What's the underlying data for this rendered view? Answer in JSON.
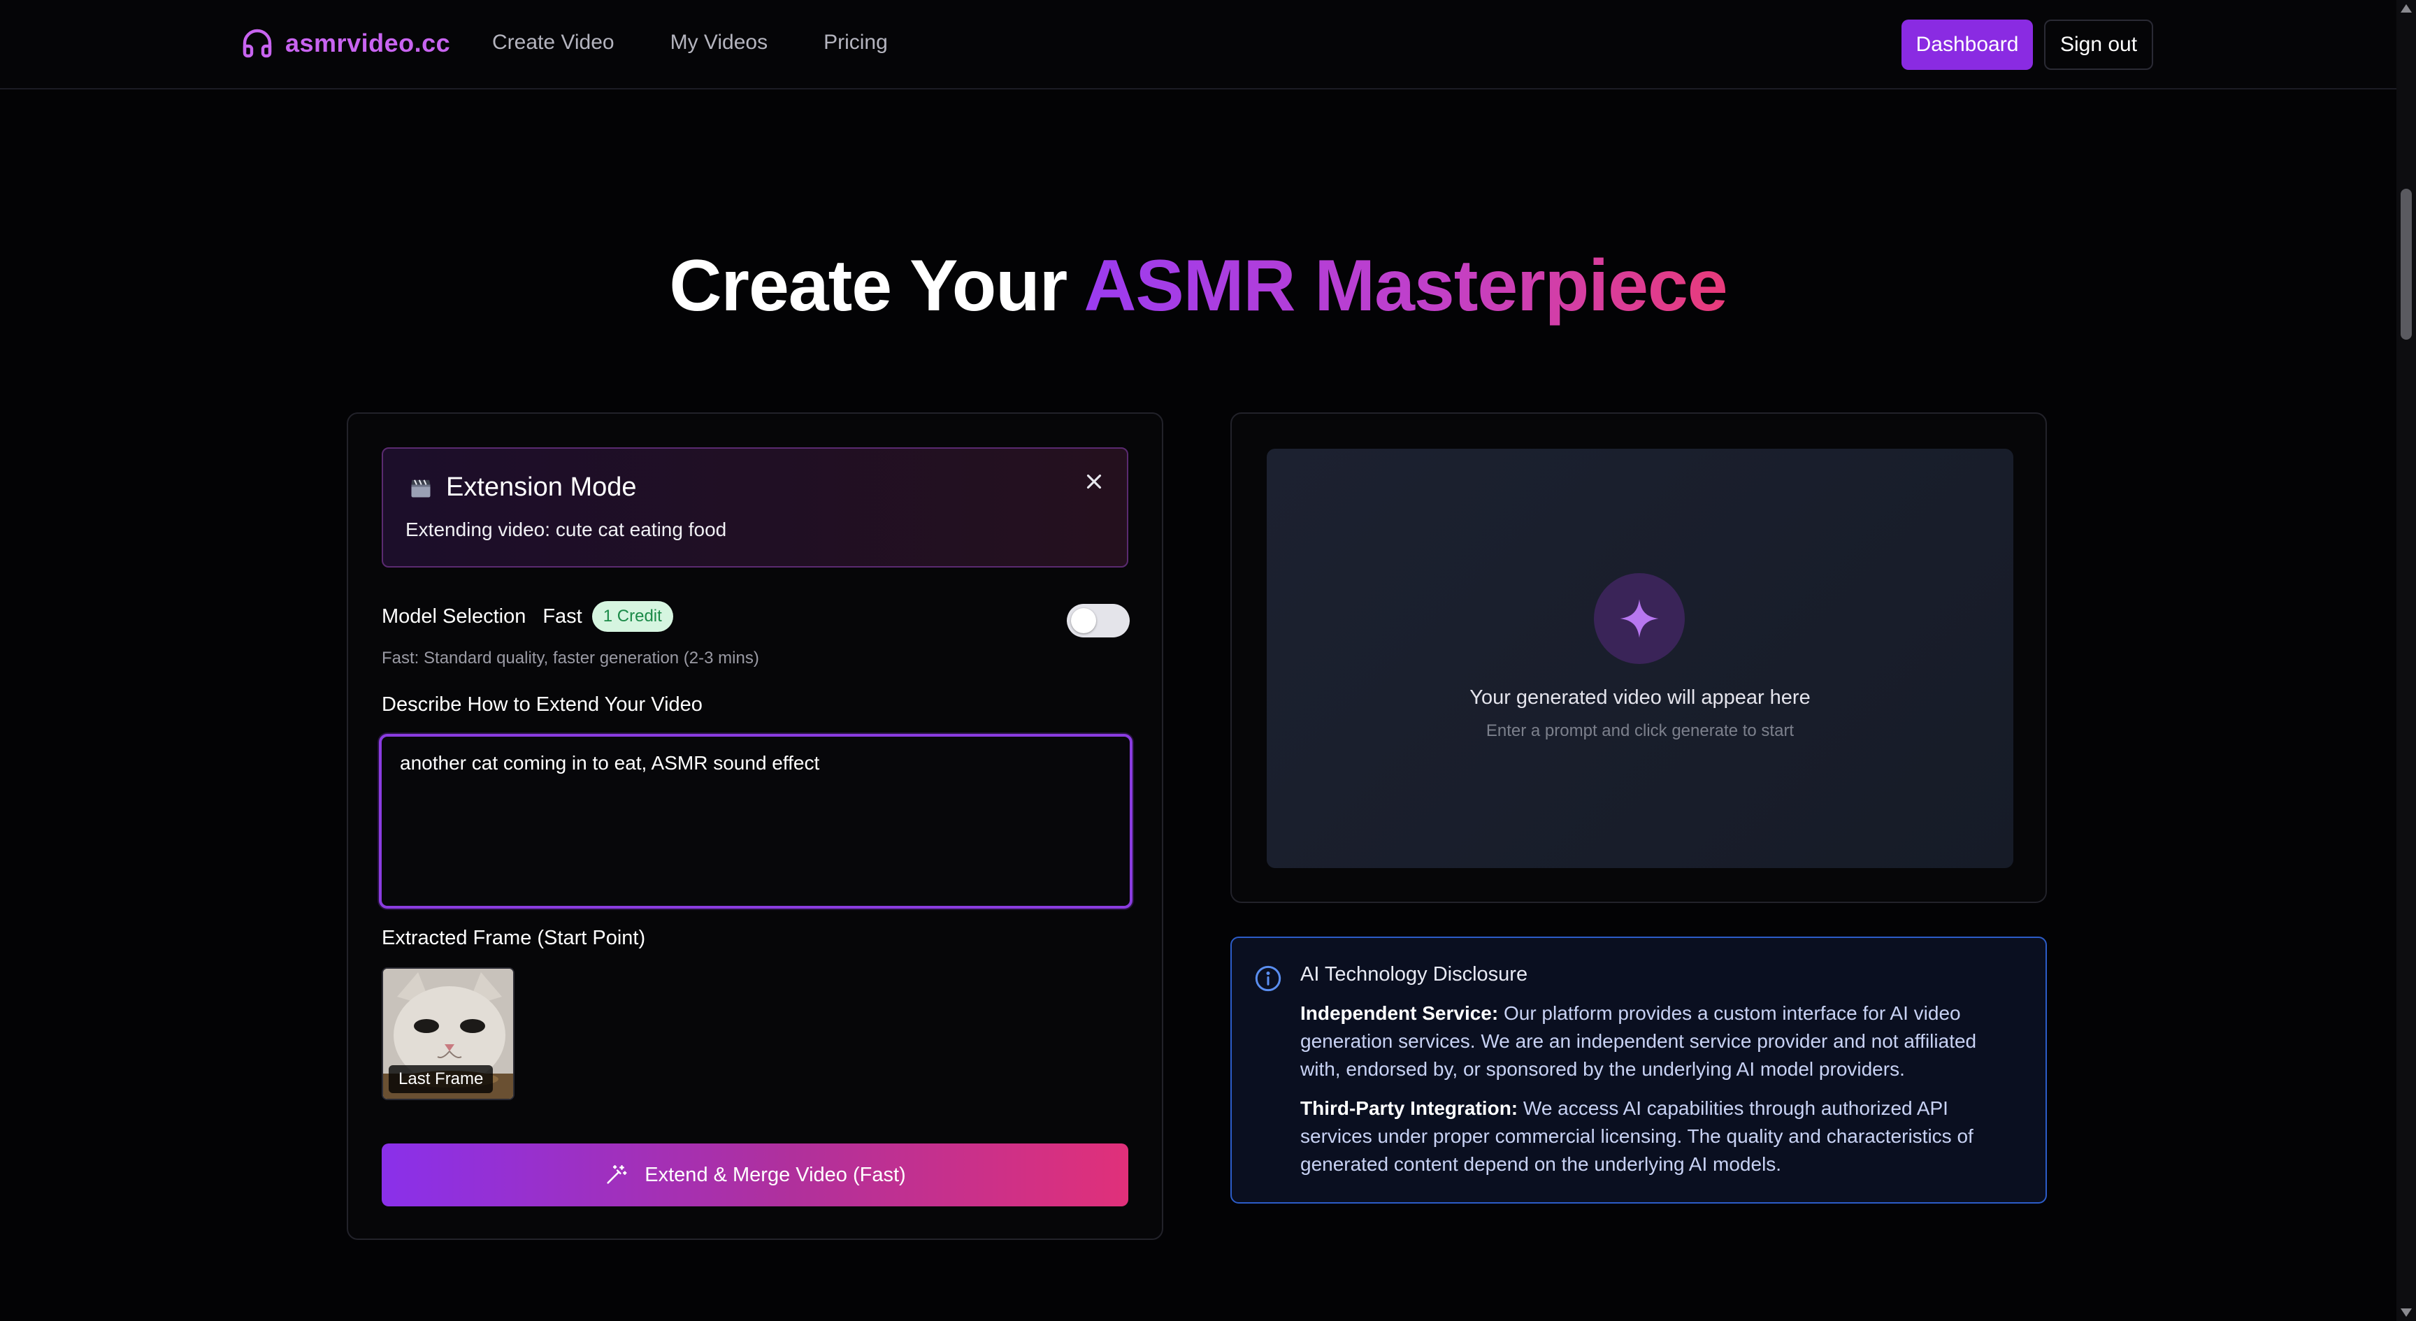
{
  "nav": {
    "brand": "asmrvideo.cc",
    "links": [
      "Create Video",
      "My Videos",
      "Pricing"
    ],
    "dashboard_label": "Dashboard",
    "signout_label": "Sign out",
    "brand_color": "#c864f0"
  },
  "hero": {
    "title_plain": "Create Your ",
    "title_highlight": "ASMR Masterpiece"
  },
  "extension": {
    "icon": "clapperboard-icon",
    "title": "Extension Mode",
    "subtitle": "Extending video: cute cat eating food"
  },
  "model": {
    "label": "Model Selection",
    "mode": "Fast",
    "credit_badge": "1 Credit",
    "toggle_on": false,
    "hint": "Fast: Standard quality, faster generation (2-3 mins)"
  },
  "prompt": {
    "label": "Describe How to Extend Your Video",
    "value": "another cat coming in to eat, ASMR sound effect"
  },
  "frame": {
    "label": "Extracted Frame (Start Point)",
    "tag": "Last Frame"
  },
  "extend_button": {
    "label": "Extend & Merge Video (Fast)",
    "icon": "magic-wand-icon"
  },
  "preview": {
    "title": "Your generated video will appear here",
    "subtitle": "Enter a prompt and click generate to start",
    "icon": "sparkle-icon"
  },
  "disclosure": {
    "icon": "info-icon",
    "title": "AI Technology Disclosure",
    "p1_bold": "Independent Service:",
    "p1_text": " Our platform provides a custom interface for AI video generation services. We are an independent service provider and not affiliated with, endorsed by, or sponsored by the underlying AI model providers.",
    "p2_bold": "Third-Party Integration:",
    "p2_text": " We access AI capabilities through authorized API services under proper commercial licensing. The quality and characteristics of generated content depend on the underlying AI models."
  },
  "colors": {
    "accent_purple": "#8a2be2",
    "accent_pink": "#e0307a",
    "disclosure_border": "#2c5cc8"
  }
}
